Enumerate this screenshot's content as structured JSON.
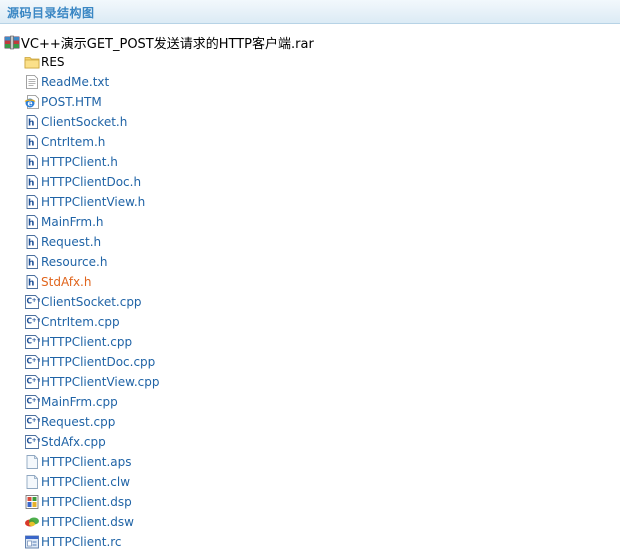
{
  "header": {
    "title": "源码目录结构图"
  },
  "root": {
    "name": "VC++演示GET_POST发送请求的HTTP客户端.rar",
    "icon": "rar-archive-icon"
  },
  "items": [
    {
      "label": "RES",
      "icon": "folder-icon",
      "style": "plain"
    },
    {
      "label": "ReadMe.txt",
      "icon": "text-file-icon",
      "style": "link"
    },
    {
      "label": "POST.HTM",
      "icon": "html-file-icon",
      "style": "link"
    },
    {
      "label": "ClientSocket.h",
      "icon": "h-file-icon",
      "style": "link"
    },
    {
      "label": "CntrItem.h",
      "icon": "h-file-icon",
      "style": "link"
    },
    {
      "label": "HTTPClient.h",
      "icon": "h-file-icon",
      "style": "link"
    },
    {
      "label": "HTTPClientDoc.h",
      "icon": "h-file-icon",
      "style": "link"
    },
    {
      "label": "HTTPClientView.h",
      "icon": "h-file-icon",
      "style": "link"
    },
    {
      "label": "MainFrm.h",
      "icon": "h-file-icon",
      "style": "link"
    },
    {
      "label": "Request.h",
      "icon": "h-file-icon",
      "style": "link"
    },
    {
      "label": "Resource.h",
      "icon": "h-file-icon",
      "style": "link"
    },
    {
      "label": "StdAfx.h",
      "icon": "h-file-icon",
      "style": "active"
    },
    {
      "label": "ClientSocket.cpp",
      "icon": "cpp-file-icon",
      "style": "link"
    },
    {
      "label": "CntrItem.cpp",
      "icon": "cpp-file-icon",
      "style": "link"
    },
    {
      "label": "HTTPClient.cpp",
      "icon": "cpp-file-icon",
      "style": "link"
    },
    {
      "label": "HTTPClientDoc.cpp",
      "icon": "cpp-file-icon",
      "style": "link"
    },
    {
      "label": "HTTPClientView.cpp",
      "icon": "cpp-file-icon",
      "style": "link"
    },
    {
      "label": "MainFrm.cpp",
      "icon": "cpp-file-icon",
      "style": "link"
    },
    {
      "label": "Request.cpp",
      "icon": "cpp-file-icon",
      "style": "link"
    },
    {
      "label": "StdAfx.cpp",
      "icon": "cpp-file-icon",
      "style": "link"
    },
    {
      "label": "HTTPClient.aps",
      "icon": "blank-file-icon",
      "style": "link"
    },
    {
      "label": "HTTPClient.clw",
      "icon": "blank-file-icon",
      "style": "link"
    },
    {
      "label": "HTTPClient.dsp",
      "icon": "dsp-file-icon",
      "style": "link"
    },
    {
      "label": "HTTPClient.dsw",
      "icon": "dsw-file-icon",
      "style": "link"
    },
    {
      "label": "HTTPClient.rc",
      "icon": "rc-file-icon",
      "style": "link"
    }
  ],
  "colors": {
    "link": "#1f63a6",
    "active": "#e0651d",
    "header_text": "#3a87c4"
  }
}
